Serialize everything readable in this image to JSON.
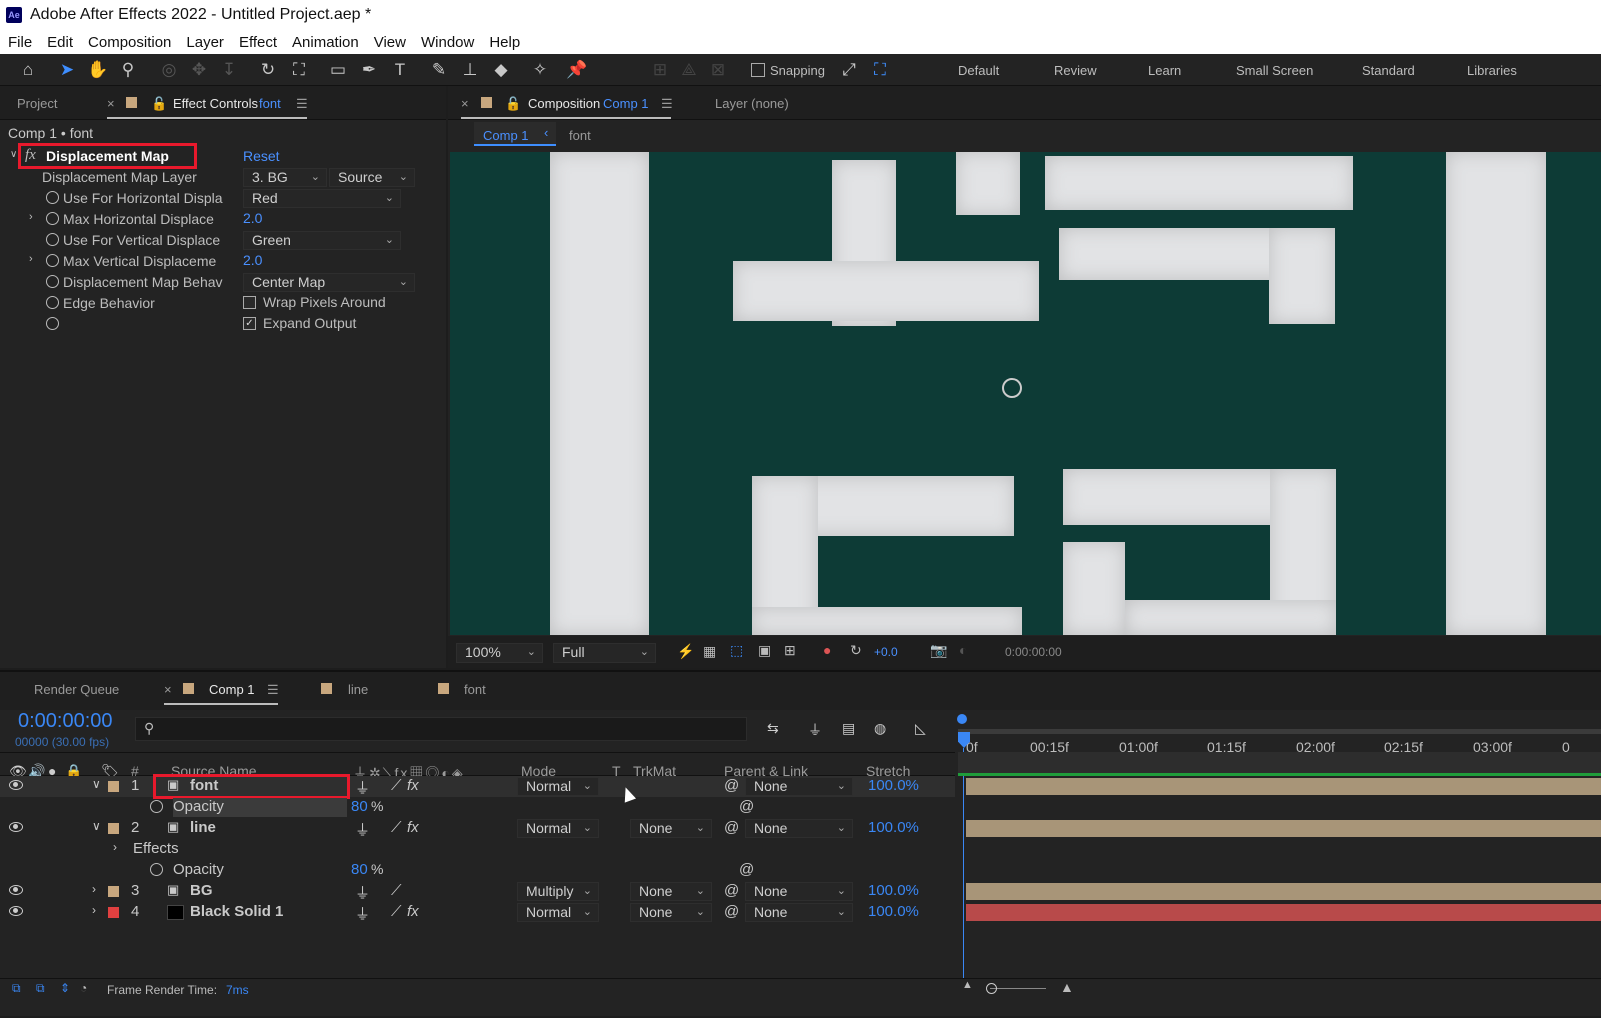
{
  "window": {
    "title": "Adobe After Effects 2022 - Untitled Project.aep *",
    "logo": "Ae"
  },
  "menu": [
    "File",
    "Edit",
    "Composition",
    "Layer",
    "Effect",
    "Animation",
    "View",
    "Window",
    "Help"
  ],
  "toolbar": {
    "snapping": "Snapping",
    "workspaces": [
      "Default",
      "Review",
      "Learn",
      "Small Screen",
      "Standard",
      "Libraries"
    ],
    "icons": [
      "home-icon",
      "selection-arrow-icon",
      "hand-icon",
      "zoom-icon",
      "orbit-icon",
      "pan-icon",
      "dolly-icon",
      "rotate-icon",
      "anchor-icon",
      "rectangle-icon",
      "pen-icon",
      "text-icon",
      "brush-icon",
      "clone-stamp-icon",
      "eraser-icon",
      "roto-brush-icon",
      "puppet-pin-icon"
    ]
  },
  "left_panel": {
    "project_tab": "Project",
    "effect_tab": "Effect Controls",
    "effect_tab_layer": "font",
    "breadcrumb": "Comp 1 • font",
    "effect": {
      "name": "Displacement Map",
      "fx": "fx",
      "reset": "Reset",
      "props": [
        {
          "label": "Displacement Map Layer",
          "value": "3. BG",
          "value2": "Source"
        },
        {
          "label": "Use For Horizontal Displa",
          "value": "Red"
        },
        {
          "label": "Max Horizontal Displace",
          "value": "2.0"
        },
        {
          "label": "Use For Vertical Displace",
          "value": "Green"
        },
        {
          "label": "Max Vertical Displaceme",
          "value": "2.0"
        },
        {
          "label": "Displacement Map Behav",
          "value": "Center Map"
        },
        {
          "label": "Edge Behavior",
          "value": "Wrap Pixels Around",
          "checked": false
        },
        {
          "label": "",
          "value": "Expand Output",
          "checked": true
        }
      ]
    }
  },
  "comp_panel": {
    "tab": "Composition",
    "tab_comp": "Comp 1",
    "layer_tab": "Layer (none)",
    "crumbs": [
      "Comp 1",
      "font"
    ],
    "zoom": "100%",
    "resolution": "Full",
    "exposure": "+0.0",
    "timecode": "0:00:00:00"
  },
  "timeline": {
    "tabs": [
      "Render Queue",
      "Comp 1",
      "line",
      "font"
    ],
    "timecode": "0:00:00:00",
    "frames": "00000 (30.00 fps)",
    "search_placeholder": "",
    "headers": {
      "num": "#",
      "source": "Source Name",
      "mode": "Mode",
      "t": "T",
      "trkmat": "TrkMat",
      "parent": "Parent & Link",
      "stretch": "Stretch"
    },
    "ruler": [
      "0f",
      "00:15f",
      "01:00f",
      "01:15f",
      "02:00f",
      "02:15f",
      "03:00f",
      "0"
    ],
    "layers": [
      {
        "num": "1",
        "name": "font",
        "mode": "Normal",
        "trkmat": "",
        "parent": "None",
        "stretch": "100.0%",
        "color": "#c8a77e"
      },
      {
        "num": "2",
        "name": "line",
        "mode": "Normal",
        "trkmat": "None",
        "parent": "None",
        "stretch": "100.0%",
        "color": "#c8a77e"
      },
      {
        "num": "3",
        "name": "BG",
        "mode": "Multiply",
        "trkmat": "None",
        "parent": "None",
        "stretch": "100.0%",
        "color": "#c8a77e"
      },
      {
        "num": "4",
        "name": "Black Solid 1",
        "mode": "Normal",
        "trkmat": "None",
        "parent": "None",
        "stretch": "100.0%",
        "color": "#e04040"
      }
    ],
    "opacity_label": "Opacity",
    "opacity_value": "80",
    "percent": "%",
    "effects_label": "Effects",
    "status": "Frame Render Time:",
    "render_time": "7ms"
  },
  "colors": {
    "accent": "#3e8eff",
    "highlight": "#e8192c",
    "bar_tan": "#a89578",
    "bar_red": "#b84a4a",
    "viewer_bg": "#0d3b36"
  }
}
